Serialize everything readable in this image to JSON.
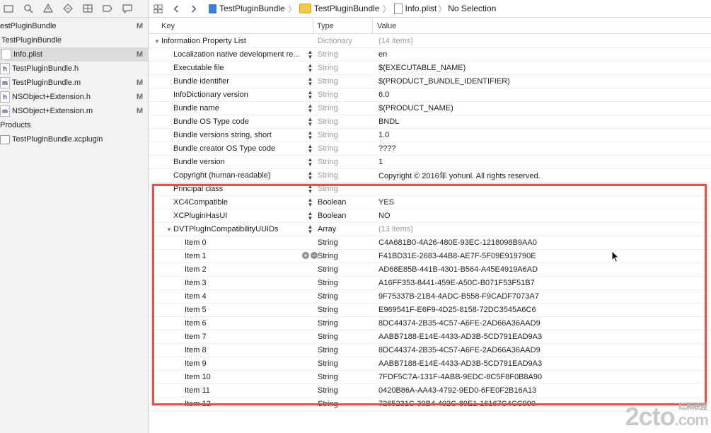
{
  "navigator": {
    "files": [
      {
        "name": "estPluginBundle",
        "badge": "M",
        "icon": "none",
        "indent": 0,
        "selected": false
      },
      {
        "name": "TestPluginBundle",
        "badge": "",
        "icon": "none",
        "indent": 2,
        "selected": false
      },
      {
        "name": "Info.plist",
        "badge": "M",
        "icon": "plist",
        "indent": 2,
        "selected": true
      },
      {
        "name": "TestPluginBundle.h",
        "badge": "",
        "icon": "h",
        "indent": 0,
        "selected": false
      },
      {
        "name": "TestPluginBundle.m",
        "badge": "M",
        "icon": "m",
        "indent": 0,
        "selected": false
      },
      {
        "name": "NSObject+Extension.h",
        "badge": "M",
        "icon": "h",
        "indent": 0,
        "selected": false
      },
      {
        "name": "NSObject+Extension.m",
        "badge": "M",
        "icon": "m",
        "indent": 0,
        "selected": false
      },
      {
        "name": "Products",
        "badge": "",
        "icon": "none",
        "indent": 0,
        "selected": false
      },
      {
        "name": "TestPluginBundle.xcplugin",
        "badge": "",
        "icon": "bundle",
        "indent": 0,
        "selected": false
      }
    ]
  },
  "jumpbar": {
    "project": "TestPluginBundle",
    "group": "TestPluginBundle",
    "file": "Info.plist",
    "selection": "No Selection"
  },
  "plist": {
    "headers": {
      "key": "Key",
      "type": "Type",
      "value": "Value"
    },
    "root": {
      "key": "Information Property List",
      "type": "Dictionary",
      "value": "(14 items)"
    },
    "entries": [
      {
        "key": "Localization native development re...",
        "type": "String",
        "value": "en"
      },
      {
        "key": "Executable file",
        "type": "String",
        "value": "$(EXECUTABLE_NAME)"
      },
      {
        "key": "Bundle identifier",
        "type": "String",
        "value": "$(PRODUCT_BUNDLE_IDENTIFIER)"
      },
      {
        "key": "InfoDictionary version",
        "type": "String",
        "value": "6.0"
      },
      {
        "key": "Bundle name",
        "type": "String",
        "value": "$(PRODUCT_NAME)"
      },
      {
        "key": "Bundle OS Type code",
        "type": "String",
        "value": "BNDL"
      },
      {
        "key": "Bundle versions string, short",
        "type": "String",
        "value": "1.0"
      },
      {
        "key": "Bundle creator OS Type code",
        "type": "String",
        "value": "????"
      },
      {
        "key": "Bundle version",
        "type": "String",
        "value": "1"
      },
      {
        "key": "Copyright (human-readable)",
        "type": "String",
        "value": "Copyright © 2016年 yohunl. All rights reserved."
      },
      {
        "key": "Principal class",
        "type": "String",
        "value": ""
      },
      {
        "key": "XC4Compatible",
        "type": "Boolean",
        "value": "YES",
        "dark": true
      },
      {
        "key": "XCPluginHasUI",
        "type": "Boolean",
        "value": "NO",
        "dark": true
      },
      {
        "key": "DVTPlugInCompatibilityUUIDs",
        "type": "Array",
        "value": "(13 items)",
        "dark": true,
        "expanded": true
      }
    ],
    "items": [
      {
        "key": "Item 0",
        "type": "String",
        "value": "C4A681B0-4A26-480E-93EC-1218098B9AA0"
      },
      {
        "key": "Item 1",
        "type": "String",
        "value": "F41BD31E-2683-44B8-AE7F-5F09E919790E",
        "hover": true
      },
      {
        "key": "Item 2",
        "type": "String",
        "value": "AD68E85B-441B-4301-B564-A45E4919A6AD"
      },
      {
        "key": "Item 3",
        "type": "String",
        "value": "A16FF353-8441-459E-A50C-B071F53F51B7"
      },
      {
        "key": "Item 4",
        "type": "String",
        "value": "9F75337B-21B4-4ADC-B558-F9CADF7073A7"
      },
      {
        "key": "Item 5",
        "type": "String",
        "value": "E969541F-E6F9-4D25-8158-72DC3545A6C6"
      },
      {
        "key": "Item 6",
        "type": "String",
        "value": "8DC44374-2B35-4C57-A6FE-2AD66A36AAD9"
      },
      {
        "key": "Item 7",
        "type": "String",
        "value": "AABB7188-E14E-4433-AD3B-5CD791EAD9A3"
      },
      {
        "key": "Item 8",
        "type": "String",
        "value": "8DC44374-2B35-4C57-A6FE-2AD66A36AAD9"
      },
      {
        "key": "Item 9",
        "type": "String",
        "value": "AABB7188-E14E-4433-AD3B-5CD791EAD9A3"
      },
      {
        "key": "Item 10",
        "type": "String",
        "value": "7FDF5C7A-131F-4ABB-9EDC-8C5F8F0B8A90"
      },
      {
        "key": "Item 11",
        "type": "String",
        "value": "0420B86A-AA43-4792-9ED0-6FE0F2B16A13"
      },
      {
        "key": "Item 12",
        "type": "String",
        "value": "7265231C-39B4-402C-89E1-16167C4CC990"
      }
    ]
  },
  "watermark": {
    "text": "2cto",
    "suffix": ".com",
    "small": "红黑联盟"
  },
  "colors": {
    "highlight": "#e0524a",
    "selected_row": "#dcdcdc",
    "muted_text": "#9b9b9b"
  }
}
